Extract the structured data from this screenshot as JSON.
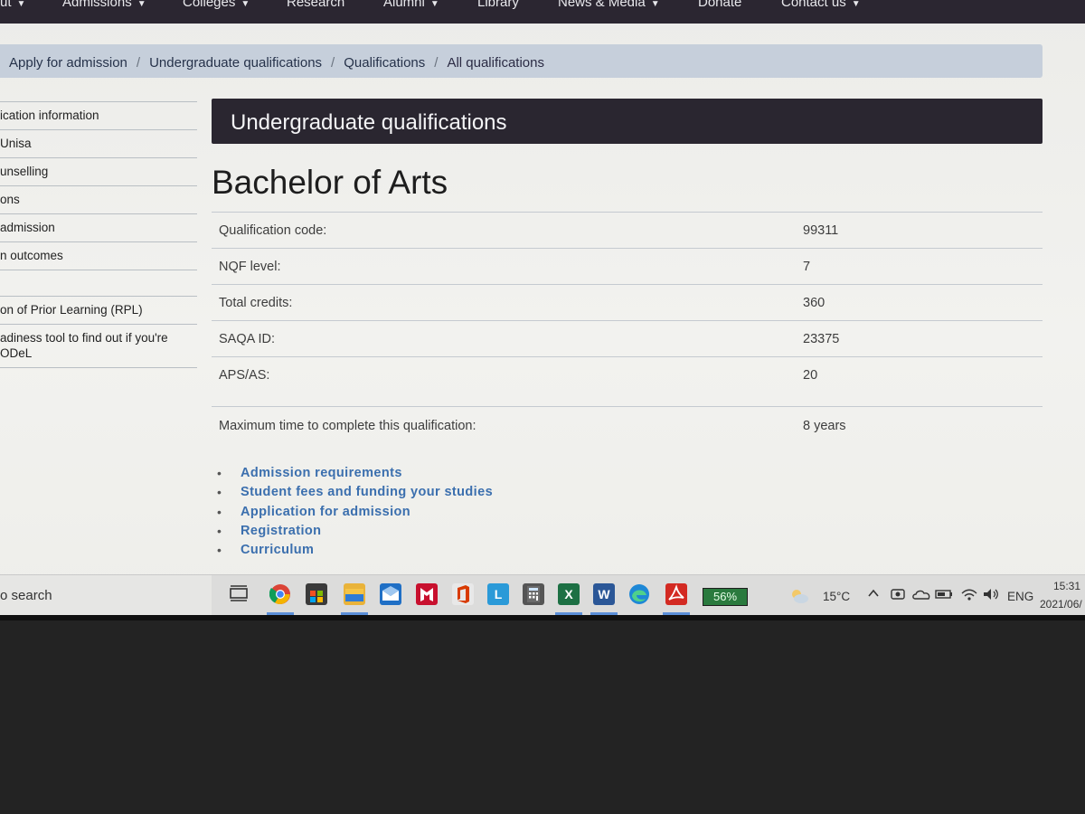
{
  "topnav": {
    "items": [
      {
        "label": "ut",
        "dropdown": true
      },
      {
        "label": "Admissions",
        "dropdown": true
      },
      {
        "label": "Colleges",
        "dropdown": true
      },
      {
        "label": "Research",
        "dropdown": false
      },
      {
        "label": "Alumni",
        "dropdown": true
      },
      {
        "label": "Library",
        "dropdown": false
      },
      {
        "label": "News & Media",
        "dropdown": true
      },
      {
        "label": "Donate",
        "dropdown": false
      },
      {
        "label": "Contact us",
        "dropdown": true
      }
    ]
  },
  "breadcrumb": [
    "Apply for admission",
    "Undergraduate qualifications",
    "Qualifications",
    "All qualifications"
  ],
  "sidebar": {
    "items": [
      "ication information",
      " Unisa",
      "unselling",
      "ons",
      "admission",
      "n outcomes",
      "",
      "on of Prior Learning (RPL)",
      "adiness tool to find out if you're\nODeL"
    ]
  },
  "content": {
    "section_heading": "Undergraduate qualifications",
    "title": "Bachelor of Arts",
    "rows": [
      {
        "label": "Qualification code:",
        "value": "99311"
      },
      {
        "label": "NQF level:",
        "value": "7"
      },
      {
        "label": "Total credits:",
        "value": "360"
      },
      {
        "label": "SAQA ID:",
        "value": "23375"
      },
      {
        "label": "APS/AS:",
        "value": "20"
      }
    ],
    "max_time": {
      "label": "Maximum time to complete this qualification:",
      "value": "8 years"
    },
    "links": [
      "Admission requirements",
      "Student fees and funding your studies",
      "Application for admission",
      "Registration",
      "Curriculum"
    ]
  },
  "taskbar": {
    "search_text": "o search",
    "battery_percent": "56%",
    "temperature": "15°C",
    "language": "ENG",
    "time": "15:31",
    "date": "2021/06/"
  },
  "colors": {
    "nav_bg": "#2b2631",
    "breadcrumb_bg": "#c6cfdb",
    "link": "#3b6fae"
  }
}
